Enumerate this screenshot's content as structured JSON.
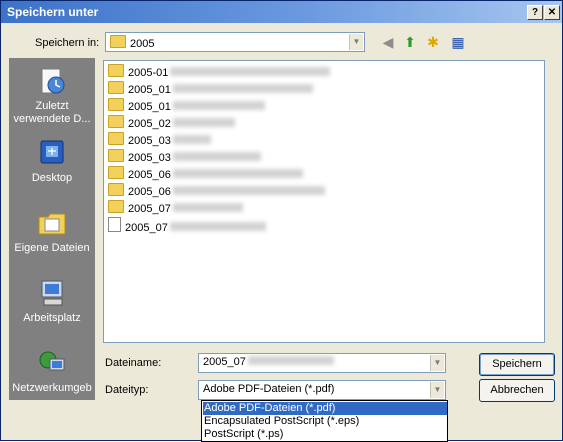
{
  "window": {
    "title": "Speichern unter",
    "help_button": "?",
    "close_button": "✕"
  },
  "location": {
    "label": "Speichern in:",
    "value": "2005"
  },
  "toolbar": {
    "back_icon": "back-arrow-icon",
    "up_icon": "up-folder-icon",
    "new_folder_icon": "new-folder-icon",
    "views_icon": "views-menu-icon"
  },
  "places": [
    {
      "label": "Zuletzt verwendete D...",
      "icon": "recent-documents-icon"
    },
    {
      "label": "Desktop",
      "icon": "desktop-icon"
    },
    {
      "label": "Eigene Dateien",
      "icon": "my-documents-icon"
    },
    {
      "label": "Arbeitsplatz",
      "icon": "my-computer-icon"
    },
    {
      "label": "Netzwerkumgeb",
      "icon": "network-icon"
    }
  ],
  "files": [
    {
      "name": "2005-01",
      "type": "folder"
    },
    {
      "name": "2005_01",
      "type": "folder"
    },
    {
      "name": "2005_01",
      "type": "folder"
    },
    {
      "name": "2005_02",
      "type": "folder"
    },
    {
      "name": "2005_03",
      "type": "folder"
    },
    {
      "name": "2005_03",
      "type": "folder"
    },
    {
      "name": "2005_06",
      "type": "folder"
    },
    {
      "name": "2005_06",
      "type": "folder"
    },
    {
      "name": "2005_07",
      "type": "folder"
    },
    {
      "name": "2005_07",
      "type": "pdf"
    }
  ],
  "filename": {
    "label": "Dateiname:",
    "value": "2005_07"
  },
  "filetype": {
    "label": "Dateityp:",
    "value": "Adobe PDF-Dateien (*.pdf)",
    "options": [
      "Adobe PDF-Dateien (*.pdf)",
      "Encapsulated PostScript (*.eps)",
      "PostScript (*.ps)"
    ]
  },
  "buttons": {
    "save": "Speichern",
    "cancel": "Abbrechen"
  }
}
